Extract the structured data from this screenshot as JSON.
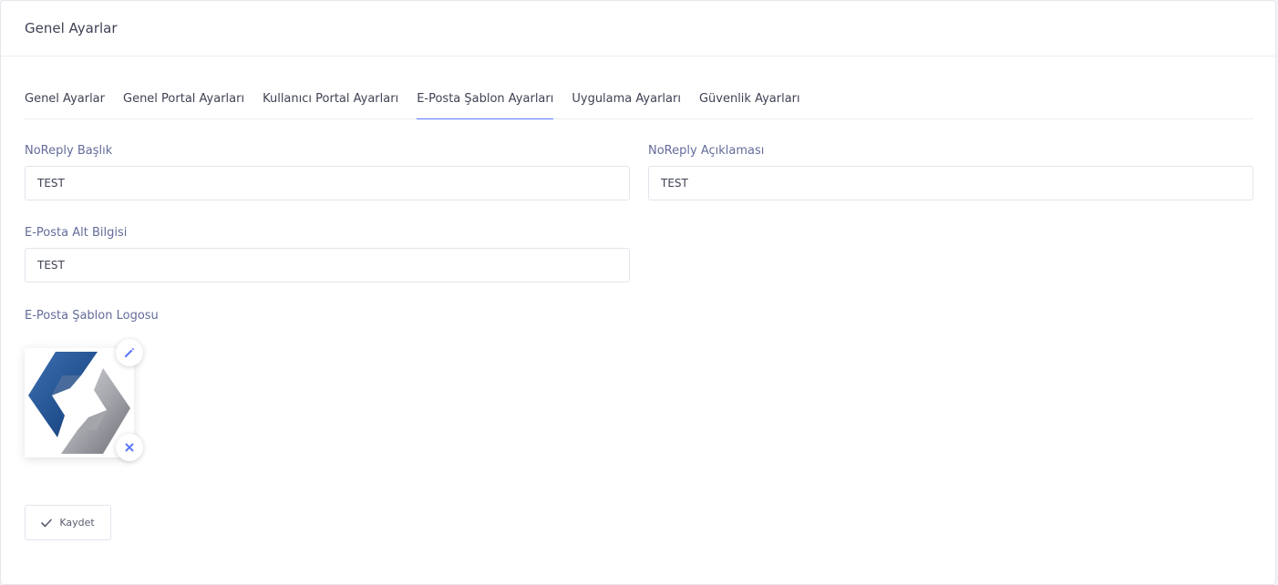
{
  "header": {
    "title": "Genel Ayarlar"
  },
  "tabs": [
    {
      "label": "Genel Ayarlar"
    },
    {
      "label": "Genel Portal Ayarları"
    },
    {
      "label": "Kullanıcı Portal Ayarları"
    },
    {
      "label": "E-Posta Şablon Ayarları",
      "active": true
    },
    {
      "label": "Uygulama Ayarları"
    },
    {
      "label": "Güvenlik Ayarları"
    }
  ],
  "form": {
    "noreply_title": {
      "label": "NoReply Başlık",
      "value": "TEST"
    },
    "noreply_desc": {
      "label": "NoReply Açıklaması",
      "value": "TEST"
    },
    "email_footer": {
      "label": "E-Posta Alt Bilgisi",
      "value": "TEST"
    },
    "logo": {
      "label": "E-Posta Şablon Logosu"
    }
  },
  "actions": {
    "save_label": "Kaydet"
  },
  "colors": {
    "accent": "#5d78ff",
    "logo_blue": "#2a5c9a",
    "logo_gray": "#9a9ca3"
  },
  "icons": {
    "edit": "pencil-icon",
    "remove": "close-icon",
    "save": "check-icon"
  }
}
